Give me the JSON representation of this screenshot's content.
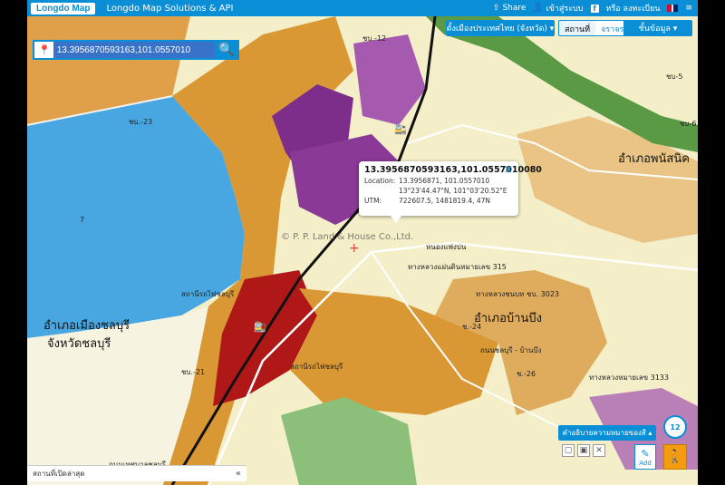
{
  "topbar": {
    "logo": "Longdo Map",
    "title": "Longdo Map Solutions & API",
    "share": "Share",
    "login": "เข้าสู่ระบบ",
    "register": "หรือ ลงทะเบียน",
    "fb": "f"
  },
  "search": {
    "value": "13.3956870593163,101.0557010",
    "button_icon": "search-icon"
  },
  "controls": {
    "region": "ตั้งเมืองประเทศไทย (จังหวัด) ▾",
    "seg": [
      "สถานที่",
      "จราจร"
    ],
    "layers": "ชั้นข้อมูล ▾"
  },
  "popup": {
    "title": "13.3956870593163,101.0557010080",
    "close": "✕",
    "rows": [
      {
        "k": "Location:",
        "v": "13.3956871, 101.0557010"
      },
      {
        "k": "",
        "v": "13°23'44.47\"N, 101°03'20.52\"E"
      },
      {
        "k": "UTM:",
        "v": "722607.5, 1481819.4, 47N"
      }
    ]
  },
  "watermark": "© P. P. Land & House Co.,Ltd.",
  "recent": {
    "label": "สถานที่เปิดล่าสุด",
    "chev": "«"
  },
  "legend": {
    "label": "คำอธิบายความหมายของสี ▴"
  },
  "zoom": "12",
  "tools": [
    "▢",
    "▣",
    "✕"
  ],
  "add": {
    "label": "Add"
  },
  "map_labels": {
    "amphoe_chonburi": "อำเภอเมืองชลบุรี",
    "changwat_chonburi": "จังหวัดชลบุรี",
    "amphoe_banbueng": "อำเภอบ้านบึง",
    "amphoe_phanat": "อำเภอพนัสนิค",
    "road_315": "ทางหลวงแผ่นดินหมายเลข 315",
    "road_3023": "ทางหลวงชนบท ชบ. 3023",
    "road_3133": "ทางหลวงหมายเลข 3133",
    "station": "สถานีรถไฟชลบุรี",
    "nongsamsap": "หนองแพ่งบ่น",
    "num7": "7",
    "cb23": "ชบ.-23",
    "cb24": "ช.-24",
    "cb26": "ช.-26",
    "cb21": "ชบ.-21",
    "cb6": "ชบ-6",
    "road_banbueng": "ถนนชลบุรี - บ้านบึง",
    "road_sukhumvit": "ถนนเทศบาลชลบุรี",
    "station2": "สถานีรถไฟชลบุรี",
    "cb12": "ชบ.-12",
    "lab5": "ชบ-5"
  },
  "colors": {
    "brand": "#0a8fd6",
    "sea": "#48a7e0",
    "beige": "#f4efc9",
    "orange": "#d99834",
    "purple": "#7c2e8a",
    "red": "#b01818",
    "green": "#5a9a45"
  }
}
